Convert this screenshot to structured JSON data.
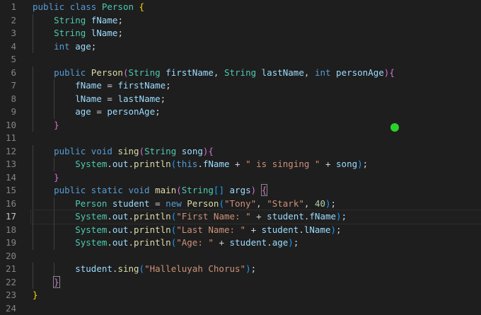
{
  "editor": {
    "current_line": 17,
    "lines": [
      {
        "n": "1",
        "t": [
          [
            "kw",
            "public "
          ],
          [
            "kw",
            "class "
          ],
          [
            "ty",
            "Person "
          ],
          [
            "b1",
            "{"
          ]
        ]
      },
      {
        "n": "2",
        "t": [
          [
            "pl",
            "    "
          ],
          [
            "ty",
            "String "
          ],
          [
            "vr",
            "fName"
          ],
          [
            "pl",
            ";"
          ]
        ]
      },
      {
        "n": "3",
        "t": [
          [
            "pl",
            "    "
          ],
          [
            "ty",
            "String "
          ],
          [
            "vr",
            "lName"
          ],
          [
            "pl",
            ";"
          ]
        ]
      },
      {
        "n": "4",
        "t": [
          [
            "pl",
            "    "
          ],
          [
            "kw",
            "int "
          ],
          [
            "vr",
            "age"
          ],
          [
            "pl",
            ";"
          ]
        ]
      },
      {
        "n": "5",
        "t": []
      },
      {
        "n": "6",
        "t": [
          [
            "pl",
            "    "
          ],
          [
            "kw",
            "public "
          ],
          [
            "fn",
            "Person"
          ],
          [
            "b2",
            "("
          ],
          [
            "ty",
            "String "
          ],
          [
            "vr",
            "firstName"
          ],
          [
            "pl",
            ", "
          ],
          [
            "ty",
            "String "
          ],
          [
            "vr",
            "lastName"
          ],
          [
            "pl",
            ", "
          ],
          [
            "kw",
            "int "
          ],
          [
            "vr",
            "personAge"
          ],
          [
            "b2",
            ")"
          ],
          [
            "b2",
            "{"
          ]
        ]
      },
      {
        "n": "7",
        "t": [
          [
            "pl",
            "        "
          ],
          [
            "vr",
            "fName"
          ],
          [
            "pl",
            " = "
          ],
          [
            "vr",
            "firstName"
          ],
          [
            "pl",
            ";"
          ]
        ]
      },
      {
        "n": "8",
        "t": [
          [
            "pl",
            "        "
          ],
          [
            "vr",
            "lName"
          ],
          [
            "pl",
            " = "
          ],
          [
            "vr",
            "lastName"
          ],
          [
            "pl",
            ";"
          ]
        ]
      },
      {
        "n": "9",
        "t": [
          [
            "pl",
            "        "
          ],
          [
            "vr",
            "age"
          ],
          [
            "pl",
            " = "
          ],
          [
            "vr",
            "personAge"
          ],
          [
            "pl",
            ";"
          ]
        ]
      },
      {
        "n": "10",
        "t": [
          [
            "pl",
            "    "
          ],
          [
            "b2",
            "}"
          ]
        ]
      },
      {
        "n": "11",
        "t": []
      },
      {
        "n": "12",
        "t": [
          [
            "pl",
            "    "
          ],
          [
            "kw",
            "public "
          ],
          [
            "kw",
            "void "
          ],
          [
            "fn",
            "sing"
          ],
          [
            "b2",
            "("
          ],
          [
            "ty",
            "String "
          ],
          [
            "vr",
            "song"
          ],
          [
            "b2",
            ")"
          ],
          [
            "b2",
            "{"
          ]
        ]
      },
      {
        "n": "13",
        "t": [
          [
            "pl",
            "        "
          ],
          [
            "ty",
            "System"
          ],
          [
            "pl",
            "."
          ],
          [
            "vr",
            "out"
          ],
          [
            "pl",
            "."
          ],
          [
            "fn",
            "println"
          ],
          [
            "b3",
            "("
          ],
          [
            "kw",
            "this"
          ],
          [
            "pl",
            "."
          ],
          [
            "vr",
            "fName"
          ],
          [
            "pl",
            " + "
          ],
          [
            "st",
            "\" is singing \""
          ],
          [
            "pl",
            " + "
          ],
          [
            "vr",
            "song"
          ],
          [
            "b3",
            ")"
          ],
          [
            "pl",
            ";"
          ]
        ]
      },
      {
        "n": "14",
        "t": [
          [
            "pl",
            "    "
          ],
          [
            "b2",
            "}"
          ]
        ]
      },
      {
        "n": "15",
        "t": [
          [
            "pl",
            "    "
          ],
          [
            "kw",
            "public "
          ],
          [
            "kw",
            "static "
          ],
          [
            "kw",
            "void "
          ],
          [
            "fn",
            "main"
          ],
          [
            "b2",
            "("
          ],
          [
            "ty",
            "String"
          ],
          [
            "b3",
            "[]"
          ],
          [
            "pl",
            " "
          ],
          [
            "vr",
            "args"
          ],
          [
            "b2",
            ")"
          ],
          [
            "pl",
            " "
          ],
          [
            "b2m",
            "{"
          ]
        ]
      },
      {
        "n": "16",
        "t": [
          [
            "pl",
            "        "
          ],
          [
            "ty",
            "Person "
          ],
          [
            "vr",
            "student"
          ],
          [
            "pl",
            " = "
          ],
          [
            "kw",
            "new "
          ],
          [
            "fn",
            "Person"
          ],
          [
            "b3",
            "("
          ],
          [
            "st",
            "\"Tony\""
          ],
          [
            "pl",
            ", "
          ],
          [
            "st",
            "\"Stark\""
          ],
          [
            "pl",
            ", "
          ],
          [
            "nu",
            "40"
          ],
          [
            "b3",
            ")"
          ],
          [
            "pl",
            ";"
          ]
        ]
      },
      {
        "n": "17",
        "t": [
          [
            "pl",
            "        "
          ],
          [
            "ty",
            "System"
          ],
          [
            "pl",
            "."
          ],
          [
            "vr",
            "out"
          ],
          [
            "pl",
            "."
          ],
          [
            "fn",
            "println"
          ],
          [
            "b3",
            "("
          ],
          [
            "st",
            "\"First Name: \""
          ],
          [
            "pl",
            " + "
          ],
          [
            "vr",
            "student"
          ],
          [
            "pl",
            "."
          ],
          [
            "vr",
            "fName"
          ],
          [
            "b3",
            ")"
          ],
          [
            "pl",
            ";"
          ]
        ]
      },
      {
        "n": "18",
        "t": [
          [
            "pl",
            "        "
          ],
          [
            "ty",
            "System"
          ],
          [
            "pl",
            "."
          ],
          [
            "vr",
            "out"
          ],
          [
            "pl",
            "."
          ],
          [
            "fn",
            "println"
          ],
          [
            "b3",
            "("
          ],
          [
            "st",
            "\"Last Name: \""
          ],
          [
            "pl",
            " + "
          ],
          [
            "vr",
            "student"
          ],
          [
            "pl",
            "."
          ],
          [
            "vr",
            "lName"
          ],
          [
            "b3",
            ")"
          ],
          [
            "pl",
            ";"
          ]
        ]
      },
      {
        "n": "19",
        "t": [
          [
            "pl",
            "        "
          ],
          [
            "ty",
            "System"
          ],
          [
            "pl",
            "."
          ],
          [
            "vr",
            "out"
          ],
          [
            "pl",
            "."
          ],
          [
            "fn",
            "println"
          ],
          [
            "b3",
            "("
          ],
          [
            "st",
            "\"Age: \""
          ],
          [
            "pl",
            " + "
          ],
          [
            "vr",
            "student"
          ],
          [
            "pl",
            "."
          ],
          [
            "vr",
            "age"
          ],
          [
            "b3",
            ")"
          ],
          [
            "pl",
            ";"
          ]
        ]
      },
      {
        "n": "20",
        "t": []
      },
      {
        "n": "21",
        "t": [
          [
            "pl",
            "        "
          ],
          [
            "vr",
            "student"
          ],
          [
            "pl",
            "."
          ],
          [
            "fn",
            "sing"
          ],
          [
            "b3",
            "("
          ],
          [
            "st",
            "\"Halleluyah Chorus\""
          ],
          [
            "b3",
            ")"
          ],
          [
            "pl",
            ";"
          ]
        ]
      },
      {
        "n": "22",
        "t": [
          [
            "pl",
            "    "
          ],
          [
            "b2m",
            "}"
          ]
        ]
      },
      {
        "n": "23",
        "t": [
          [
            "b1",
            "}"
          ]
        ]
      },
      {
        "n": "24",
        "t": []
      }
    ]
  },
  "colors": {
    "background": "#1e1e1e",
    "keyword": "#569cd6",
    "type": "#4ec9b0",
    "variable": "#9cdcfe",
    "function": "#dcdcaa",
    "string": "#ce9178",
    "number": "#b5cea8",
    "cursor_dot": "#2bd12b"
  }
}
